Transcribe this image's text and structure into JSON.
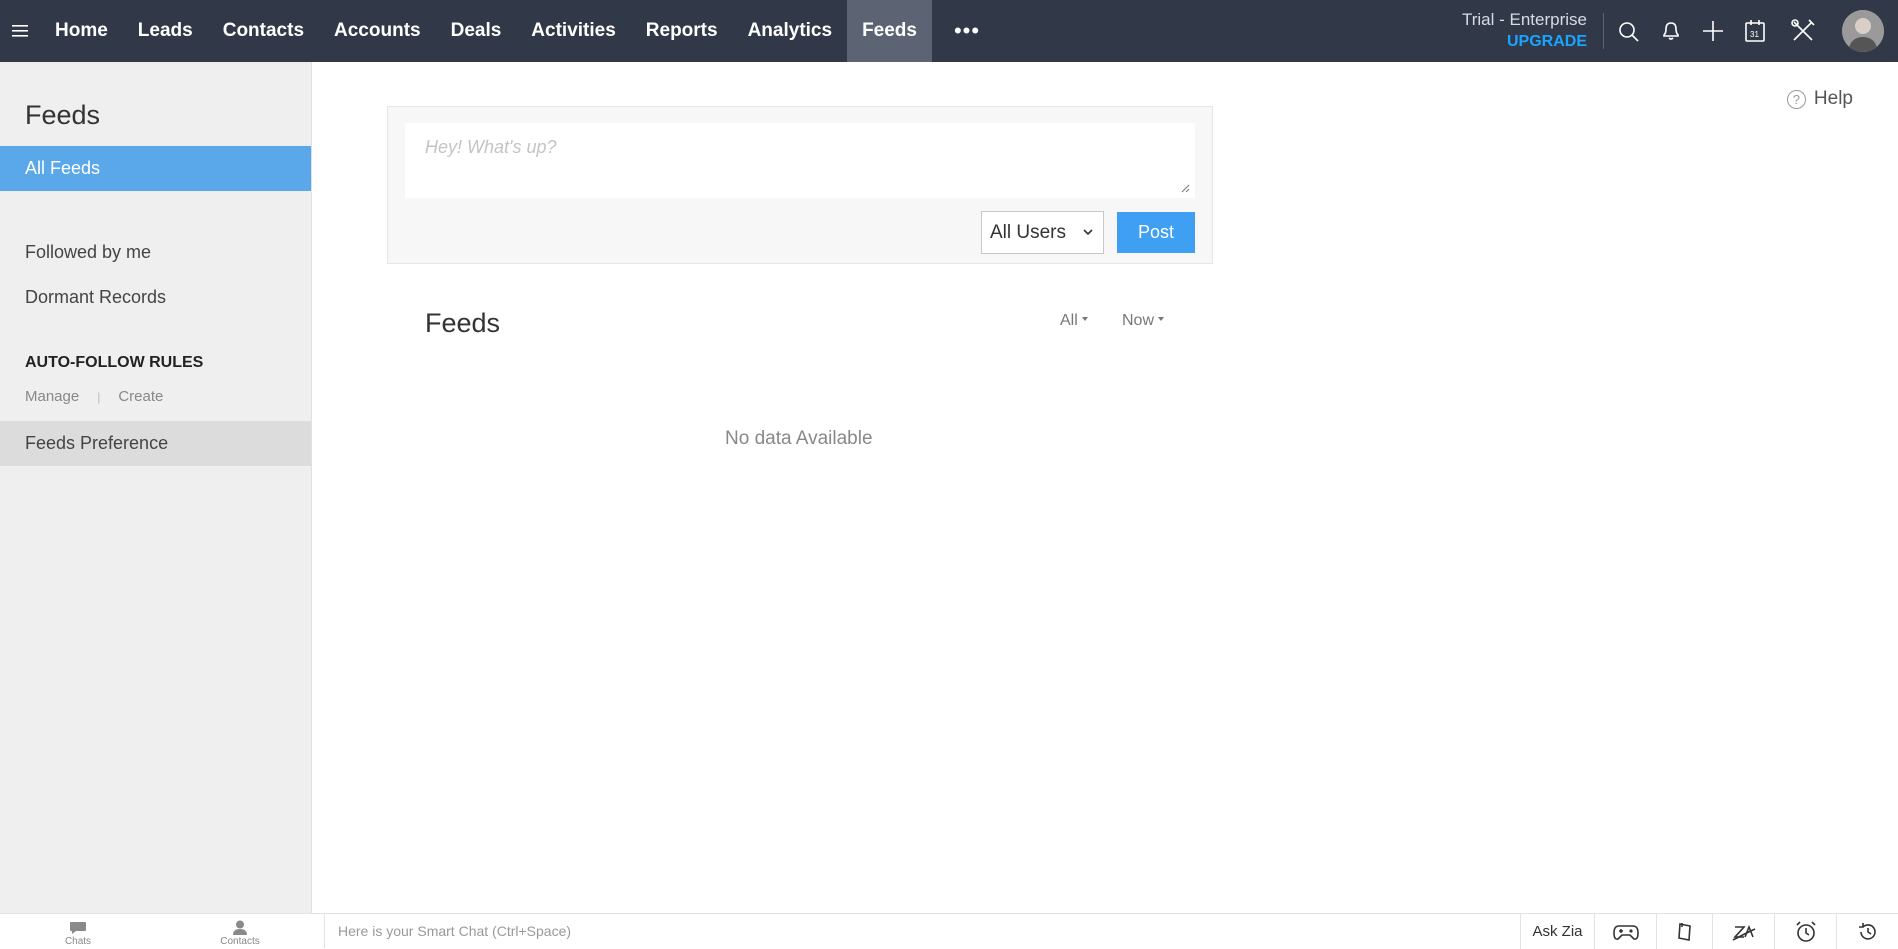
{
  "topnav": {
    "items": [
      {
        "label": "Home"
      },
      {
        "label": "Leads"
      },
      {
        "label": "Contacts"
      },
      {
        "label": "Accounts"
      },
      {
        "label": "Deals"
      },
      {
        "label": "Activities"
      },
      {
        "label": "Reports"
      },
      {
        "label": "Analytics"
      },
      {
        "label": "Feeds",
        "active": true
      }
    ],
    "more": "•••",
    "plan": "Trial - Enterprise",
    "upgrade": "UPGRADE",
    "icons": [
      "search-icon",
      "bell-icon",
      "plus-icon",
      "calendar-icon",
      "tools-icon",
      "avatar"
    ]
  },
  "sidebar": {
    "title": "Feeds",
    "all_feeds": "All Feeds",
    "followed": "Followed by me",
    "dormant": "Dormant Records",
    "section": "AUTO-FOLLOW RULES",
    "manage": "Manage",
    "divider": "|",
    "create": "Create",
    "preference": "Feeds Preference"
  },
  "help": {
    "label": "Help",
    "glyph": "?"
  },
  "composer": {
    "placeholder": "Hey! What's up?",
    "users_selected": "All Users",
    "post": "Post"
  },
  "feeds": {
    "heading": "Feeds",
    "filter_all": "All",
    "filter_now": "Now",
    "empty": "No data Available"
  },
  "bottombar": {
    "chats": "Chats",
    "contacts": "Contacts",
    "smart_chat": "Here is your Smart Chat (Ctrl+Space)",
    "ask_zia": "Ask Zia",
    "icons": [
      "gamepad-icon",
      "note-icon",
      "zia-icon",
      "alarm-icon",
      "history-icon"
    ]
  },
  "colors": {
    "topbar": "#313949",
    "accent": "#3f9ff2",
    "sidebar_active": "#5aa7e9",
    "upgrade": "#1aa3ff"
  }
}
